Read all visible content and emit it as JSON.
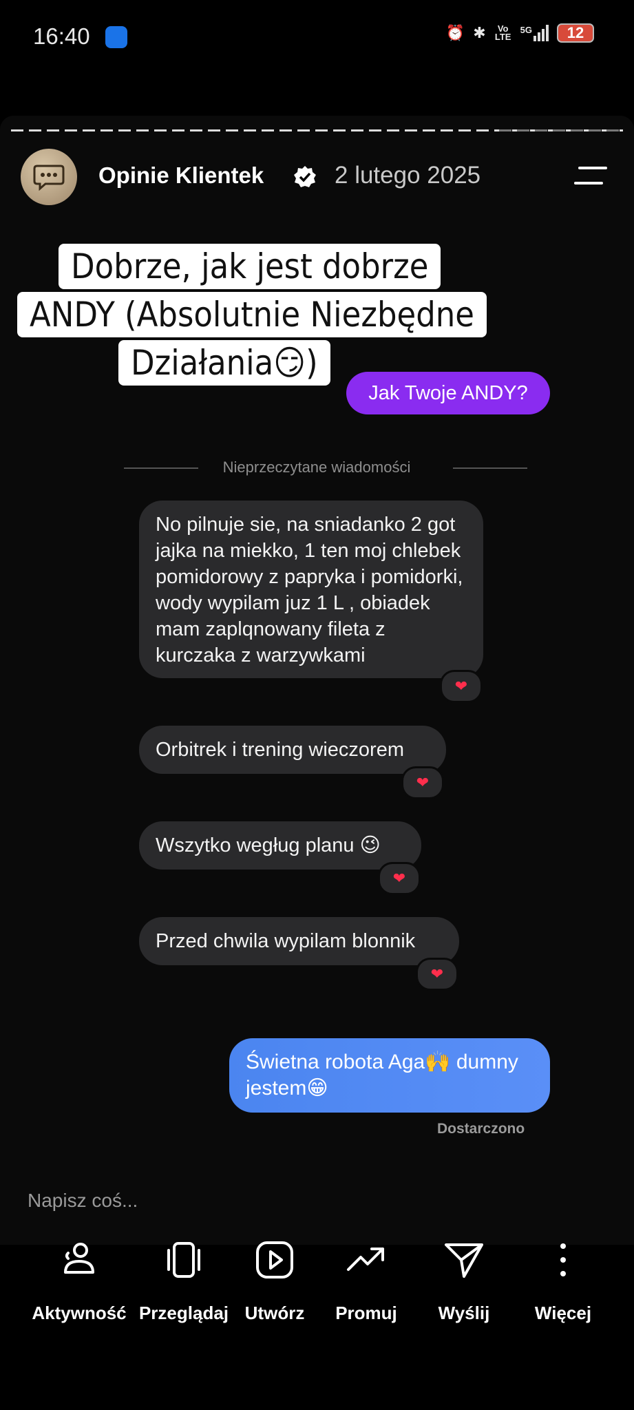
{
  "status_bar": {
    "time": "16:40",
    "network": "5G",
    "volte": "Vo LTE",
    "battery": "12"
  },
  "header": {
    "account_name": "Opinie Klientek",
    "date": "2 lutego 2025"
  },
  "caption": {
    "line1": "Dobrze, jak jest dobrze",
    "line2": "ANDY (Absolutnie Niezbędne",
    "line3": "Działania😏)"
  },
  "sticker": {
    "label": "Jak Twoje ANDY?"
  },
  "unread_divider": "Nieprzeczytane wiadomości",
  "messages": [
    {
      "text": "No pilnuje sie, na sniadanko 2 got jajka na miekko, 1 ten moj chlebek pomidorowy z papryka i pomidorki, wody wypilam juz 1 L , obiadek mam zaplqnowany fileta z kurczaka z warzywkami",
      "reaction": "❤"
    },
    {
      "text": "Orbitrek i trening wieczorem",
      "reaction": "❤"
    },
    {
      "text": "Wszytko wegług planu 😉",
      "reaction": "❤"
    },
    {
      "text": "Przed chwila wypilam blonnik",
      "reaction": "❤"
    }
  ],
  "sent_message": {
    "text": "Świetna robota Aga🙌 dumny jestem😁",
    "status": "Dostarczono"
  },
  "compose": {
    "placeholder": "Napisz coś..."
  },
  "toolbar": [
    {
      "label": "Aktywność",
      "icon": "activity-icon"
    },
    {
      "label": "Przeglądaj",
      "icon": "browse-icon"
    },
    {
      "label": "Utwórz",
      "icon": "create-icon"
    },
    {
      "label": "Promuj",
      "icon": "promote-icon"
    },
    {
      "label": "Wyślij",
      "icon": "send-icon"
    },
    {
      "label": "Więcej",
      "icon": "more-icon"
    }
  ],
  "colors": {
    "sticker": "#8a2cf0",
    "sent_bubble": "#4b85f0",
    "received_bubble": "#2a2a2c",
    "reaction_heart": "#ff2e4c"
  }
}
